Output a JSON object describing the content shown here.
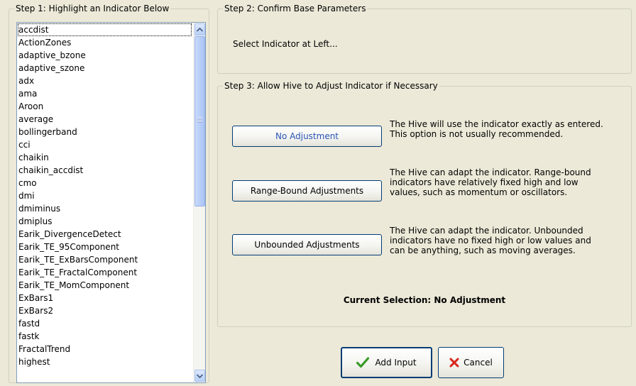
{
  "step1": {
    "title": "Step 1: Highlight an Indicator Below",
    "indicators": [
      "accdist",
      "ActionZones",
      "adaptive_bzone",
      "adaptive_szone",
      "adx",
      "ama",
      "Aroon",
      "average",
      "bollingerband",
      "cci",
      "chaikin",
      "chaikin_accdist",
      "cmo",
      "dmi",
      "dmiminus",
      "dmiplus",
      "Earik_DivergenceDetect",
      "Earik_TE_95Component",
      "Earik_TE_ExBarsComponent",
      "Earik_TE_FractalComponent",
      "Earik_TE_MomComponent",
      "ExBars1",
      "ExBars2",
      "fastd",
      "fastk",
      "FractalTrend",
      "highest"
    ],
    "focused_index": 0
  },
  "step2": {
    "title": "Step 2: Confirm Base Parameters",
    "prompt": "Select Indicator at Left..."
  },
  "step3": {
    "title": "Step 3: Allow Hive to Adjust Indicator if Necessary",
    "options": [
      {
        "button": "No Adjustment",
        "description": [
          "The Hive will use the indicator exactly as entered.",
          "This option is not usually recommended."
        ]
      },
      {
        "button": "Range-Bound Adjustments",
        "description": [
          "The Hive can adapt the indicator. Range-bound",
          "indicators have relatively fixed high and low",
          "values, such as momentum or oscillators."
        ]
      },
      {
        "button": "Unbounded Adjustments",
        "description": [
          "The Hive can adapt the indicator. Unbounded",
          "indicators have no fixed high or low values and",
          "can be anything, such as moving averages."
        ]
      }
    ],
    "current_selection": "Current Selection: No Adjustment"
  },
  "footer": {
    "add_label": "Add Input",
    "cancel_label": "Cancel",
    "add_icon": "checkmark-icon",
    "cancel_icon": "x-icon"
  },
  "colors": {
    "background": "#ece9d8",
    "selected_option_text": "#2a55b7",
    "check_green": "#3a9a2a",
    "cancel_red": "#d8261b"
  }
}
